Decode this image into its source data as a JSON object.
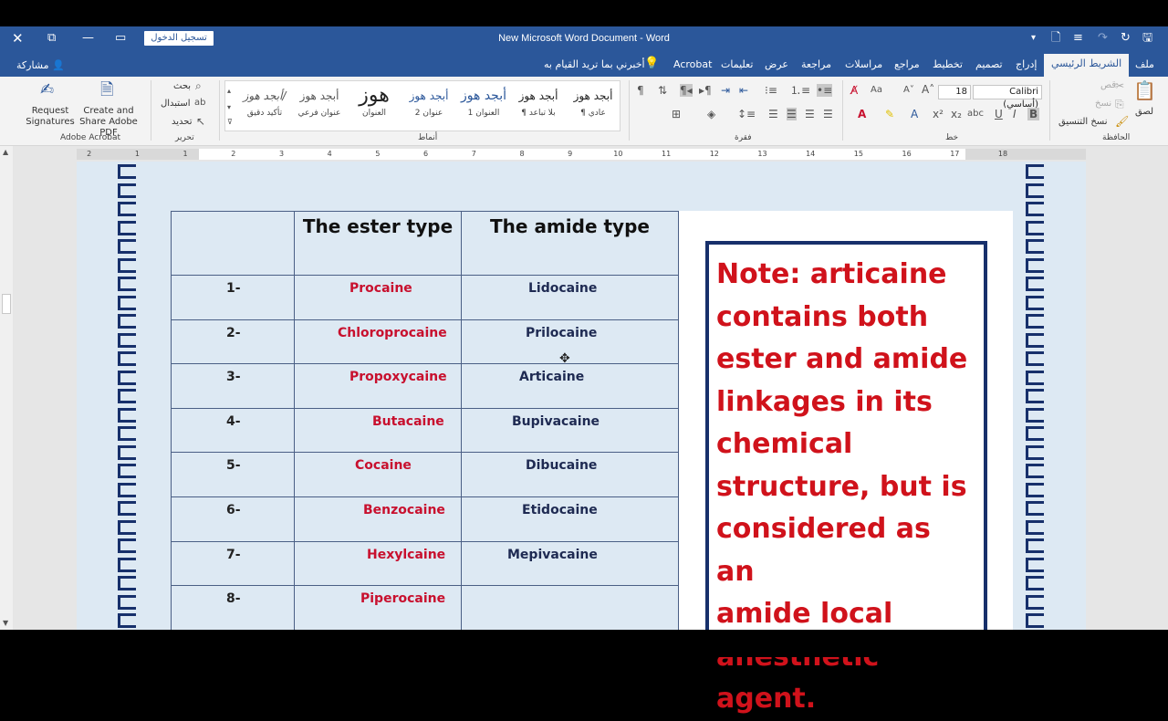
{
  "window": {
    "title": "New Microsoft Word Document  -  Word",
    "signin_label": "تسجيل الدخول"
  },
  "tabs": [
    {
      "label": "ملف"
    },
    {
      "label": "الشريط الرئيسي",
      "active": true
    },
    {
      "label": "إدراج"
    },
    {
      "label": "تصميم"
    },
    {
      "label": "تخطيط"
    },
    {
      "label": "مراجع"
    },
    {
      "label": "مراسلات"
    },
    {
      "label": "مراجعة"
    },
    {
      "label": "عرض"
    },
    {
      "label": "تعليمات"
    },
    {
      "label": "Acrobat"
    }
  ],
  "tell_me": "أخبرني بما تريد القيام به",
  "share_label": "مشاركة",
  "ribbon": {
    "acrobat": {
      "request_signatures": "Request Signatures",
      "create_share": "Create and Share Adobe PDF",
      "group_label": "Adobe Acrobat"
    },
    "editing": {
      "find": "بحث",
      "replace": "استبدال",
      "select": "تحديد",
      "group_label": "تحرير"
    },
    "styles": {
      "group_label": "أنماط",
      "items": [
        {
          "preview": "أبجد هوز",
          "name": "¶ عادي"
        },
        {
          "preview": "أبجد هوز",
          "name": "¶ بلا تباعد"
        },
        {
          "preview": "أبجد هوز",
          "name": "العنوان 1"
        },
        {
          "preview": "أبجد هوز",
          "name": "عنوان 2"
        },
        {
          "preview": "هوز",
          "name": "العنوان"
        },
        {
          "preview": "أبجد هوز",
          "name": "عنوان فرعي"
        },
        {
          "preview": "أبجد هوز/",
          "name": "تأكيد دقيق"
        }
      ]
    },
    "paragraph": {
      "group_label": "فقرة"
    },
    "font": {
      "group_label": "خط",
      "font_name": "Calibri (أساسي)",
      "font_size": "18"
    },
    "clipboard": {
      "group_label": "الحافظة",
      "paste": "لصق",
      "cut": "قص",
      "copy": "نسخ",
      "format_painter": "نسخ التنسيق"
    }
  },
  "ruler_numbers": [
    "18",
    "17",
    "16",
    "15",
    "14",
    "13",
    "12",
    "11",
    "10",
    "9",
    "8",
    "7",
    "6",
    "5",
    "4",
    "3",
    "2",
    "1",
    "1",
    "2"
  ],
  "table": {
    "headers": {
      "num": "",
      "ester": "The ester type",
      "amide": "The amide type"
    },
    "rows": [
      {
        "num": "1-",
        "ester": "Procaine",
        "amide": "Lidocaine"
      },
      {
        "num": "2-",
        "ester": "Chloroprocaine",
        "amide": "Prilocaine"
      },
      {
        "num": "3-",
        "ester": "Propoxycaine",
        "amide": "Articaine"
      },
      {
        "num": "4-",
        "ester": "Butacaine",
        "amide": "Bupivacaine"
      },
      {
        "num": "5-",
        "ester": "Cocaine",
        "amide": "Dibucaine"
      },
      {
        "num": "6-",
        "ester": "Benzocaine",
        "amide": "Etidocaine"
      },
      {
        "num": "7-",
        "ester": "Hexylcaine",
        "amide": "Mepivacaine"
      },
      {
        "num": "8-",
        "ester": "Piperocaine",
        "amide": ""
      }
    ]
  },
  "note": {
    "lines": [
      "Note: articaine",
      "contains both",
      "ester and amide",
      "linkages in its",
      "chemical",
      "structure, but is",
      "considered as an",
      "amide local",
      "anesthetic agent."
    ]
  },
  "colors": {
    "title_bar": "#2b579a",
    "ester_text": "#c8102e",
    "amide_text": "#1e2a52",
    "note_text": "#d0121b",
    "border_navy": "#17306b"
  }
}
